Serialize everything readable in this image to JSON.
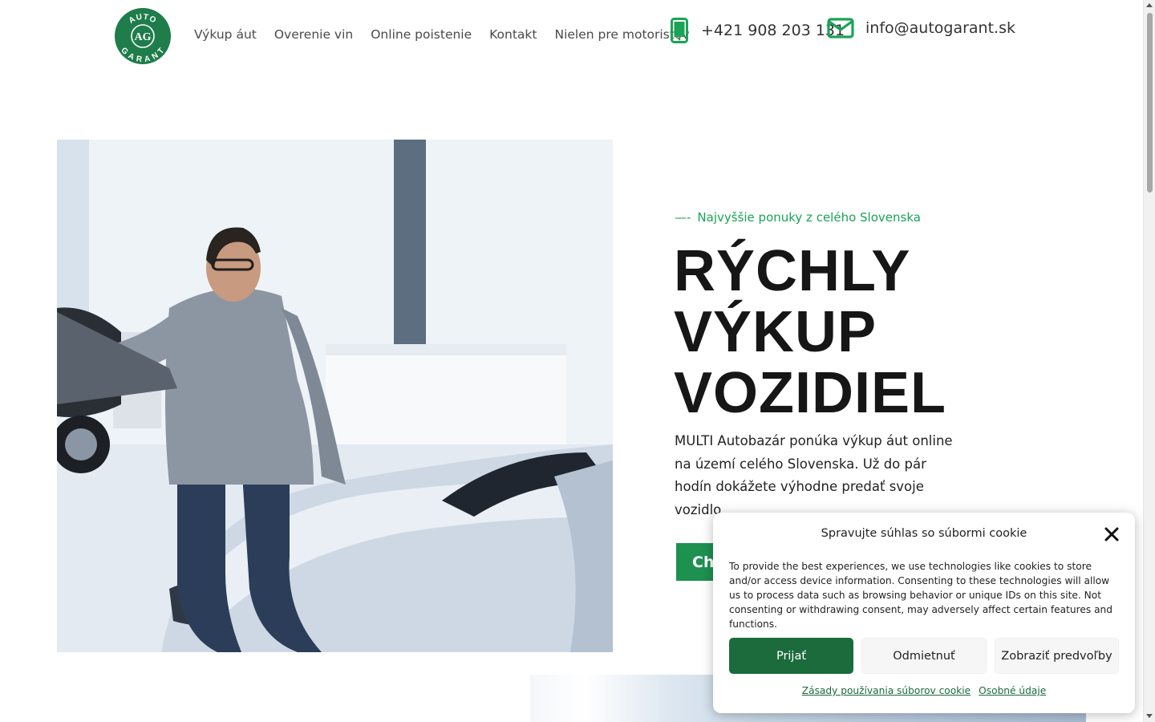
{
  "header": {
    "logo": {
      "top_text": "AUTO",
      "monogram": "AG",
      "bottom_text": "GARANT"
    },
    "nav": [
      {
        "label": "Výkup áut"
      },
      {
        "label": "Overenie vin"
      },
      {
        "label": "Online poistenie"
      },
      {
        "label": "Kontakt"
      },
      {
        "label": "Nielen pre motoristov"
      }
    ],
    "phone": {
      "icon": "mobile-phone-icon",
      "text": "+421 908 203 131"
    },
    "email": {
      "icon": "envelope-icon",
      "text": "info@autogarant.sk"
    }
  },
  "hero": {
    "kicker_dash": "—-",
    "kicker": "Najvyššie ponuky z celého Slovenska",
    "headline": [
      "RÝCHLY",
      "VÝKUP",
      "VOZIDIEL"
    ],
    "lead": "MULTI Autobazár ponúka výkup áut online na území celého Slovenska. Už do pár hodín dokážete výhodne predať svoje vozidlo",
    "cta_label": "Chcem predať auto"
  },
  "cookie_dialog": {
    "title": "Spravujte súhlas so súbormi cookie",
    "close_icon": "close-icon",
    "text": "To provide the best experiences, we use technologies like cookies to store and/or access device information. Consenting to these technologies will allow us to process data such as browsing behavior or unique IDs on this site. Not consenting or withdrawing consent, may adversely affect certain features and functions.",
    "accept_label": "Prijať",
    "deny_label": "Odmietnuť",
    "prefs_label": "Zobraziť predvoľby",
    "links": [
      {
        "label": "Zásady používania súborov cookie"
      },
      {
        "label": "Osobné údaje"
      }
    ]
  },
  "colors": {
    "brand_green": "#1aa356",
    "logo_green": "#1e7d4a",
    "accept_green": "#1b6b3d",
    "heading": "#161616"
  }
}
